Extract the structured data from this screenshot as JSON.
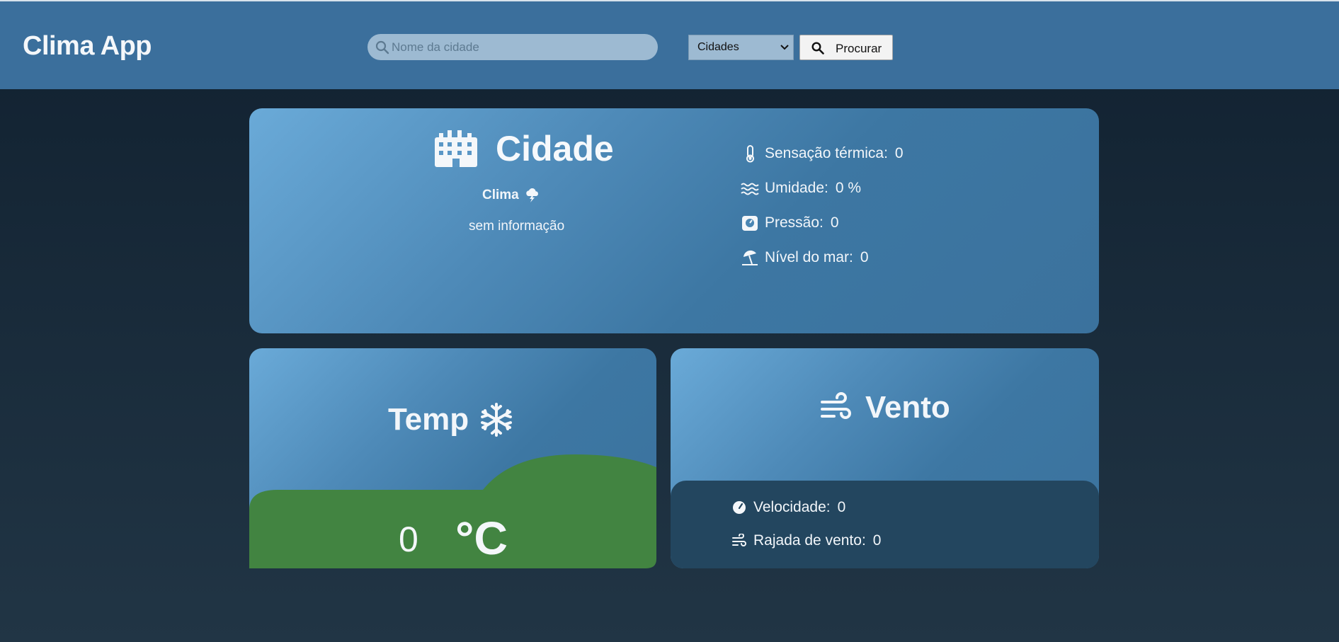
{
  "header": {
    "title": "Clima App",
    "search": {
      "placeholder": "Nome da cidade",
      "value": ""
    },
    "city_select": {
      "selected": "Cidades"
    },
    "search_button_label": "Procurar"
  },
  "main_card": {
    "city_name": "Cidade",
    "weather_label": "Clima",
    "weather_description": "sem informação",
    "stats": [
      {
        "label": "Sensação térmica:",
        "value": "0",
        "icon": "thermometer-icon"
      },
      {
        "label": "Umidade:",
        "value": "0 %",
        "icon": "water-icon"
      },
      {
        "label": "Pressão:",
        "value": "0",
        "icon": "pressure-gauge-icon"
      },
      {
        "label": "Nível do mar:",
        "value": "0",
        "icon": "umbrella-beach-icon"
      }
    ]
  },
  "temp_card": {
    "title": "Temp",
    "value": "0",
    "unit": "°C",
    "icon": "snowflake-icon"
  },
  "wind_card": {
    "title": "Vento",
    "icon": "wind-icon",
    "stats": [
      {
        "label": "Velocidade:",
        "value": "0",
        "icon": "speedometer-icon"
      },
      {
        "label": "Rajada de vento:",
        "value": "0",
        "icon": "wind-gust-icon"
      }
    ]
  },
  "colors": {
    "header_bg": "#3b6f9c",
    "card_gradient_start": "#6aaad8",
    "card_gradient_end": "#3b729d",
    "hill": "#428441",
    "wind_panel": "#23465f",
    "page_bg": "#112130"
  }
}
